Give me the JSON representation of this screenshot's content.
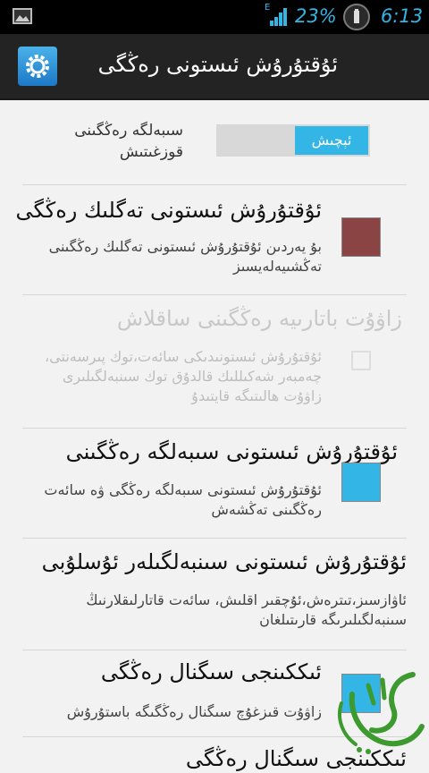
{
  "statusbar": {
    "network": "E",
    "battery": "23%",
    "time": "6:13"
  },
  "actionbar": {
    "title": "ئۇقتۇرۇش ئىستونى رەڭگى"
  },
  "language": {
    "label": "سىبەلگە رەڭگىنى قوزغىتىش",
    "toggle_label": "ئېچىش"
  },
  "prefs": [
    {
      "title": "ئۇقتۇرۇش ئىستونى تەگلىك رەڭگى",
      "summary": "بۇ يەردىن ئۇقتۇرۇش ئىستونى تەگلىك رەڭگىنى تەڭشىيەلەيسىز",
      "control": "swatch",
      "color": "#8b4444",
      "enabled": true
    },
    {
      "title": "زاۋۇت باتارىيە رەڭگىنى ساقلاش",
      "summary": "ئۇقتۇرۇش ئىستونىدىكى سائەت،توك پىرسەنتى، چەمبەر شەكىللىك قالدۇق توك سىنبەلگىلىرى زاۋۇت ھالىتىگە قايتىدۇ",
      "control": "checkbox",
      "color": "",
      "enabled": false
    },
    {
      "title": "ئۇقتۇرۇش ئىستونى سىبەلگە رەڭگىنى",
      "summary": "ئۇقتۇرۇش ئىستونى سىبەلگە رەڭگى ۋە سائەت رەڭگىنى تەڭشەش",
      "control": "swatch",
      "color": "#33b5e5",
      "enabled": true
    },
    {
      "title": "ئۇقتۇرۇش ئىستونى سىنبەلگىلەر ئۇسلۇبى",
      "summary": "ئاۋازسىز،تىترەش،ئۇچقىر اقلىش، سائەت قاتارلىقلارنىڭ سىنبەلگىلىرىگە قارىتىلغان",
      "control": "none",
      "color": "",
      "enabled": true
    },
    {
      "title": "ئىككىنجى سىگنال رەڭگى",
      "summary": "زاۋۇت قىزغۇچ سىگنال رەڭگىگە باستۇرۇش",
      "control": "swatch",
      "color": "#33b5e5",
      "enabled": true
    },
    {
      "title": "ئىككىنجى سىگنال رەڭگى",
      "summary": "",
      "control": "none",
      "color": "",
      "enabled": true
    }
  ],
  "icons": {
    "gallery": "gallery-icon",
    "signal": "signal-icon",
    "settings": "gear-icon",
    "watermark": "watermark-logo"
  },
  "colors": {
    "accent": "#33b5e5",
    "actionbar": "#232323",
    "statusbar": "#000000",
    "background": "#f2f2f2"
  }
}
